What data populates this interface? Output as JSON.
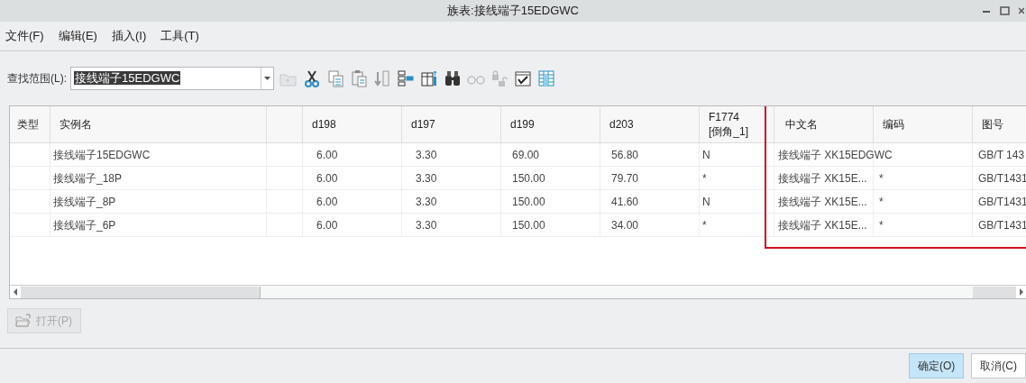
{
  "window": {
    "title": "族表:接线端子15EDGWC"
  },
  "menu": [
    {
      "label": "文件(F)"
    },
    {
      "label": "编辑(E)"
    },
    {
      "label": "插入(I)"
    },
    {
      "label": "工具(T)"
    }
  ],
  "lookup": {
    "label": "查找范围(L):",
    "value": "接线端子15EDGWC"
  },
  "toolbar": [
    {
      "kind": "folder-up",
      "disabled": true
    },
    {
      "kind": "scissors",
      "disabled": false
    },
    {
      "kind": "copy",
      "disabled": false
    },
    {
      "kind": "paste",
      "disabled": false
    },
    {
      "kind": "insert-row",
      "disabled": false
    },
    {
      "kind": "tree",
      "disabled": false
    },
    {
      "kind": "insert-column",
      "disabled": false
    },
    {
      "kind": "binoculars",
      "disabled": false
    },
    {
      "kind": "glasses",
      "disabled": true
    },
    {
      "kind": "locks",
      "disabled": true
    },
    {
      "kind": "checkbox",
      "disabled": false
    },
    {
      "kind": "table",
      "disabled": false
    }
  ],
  "table": {
    "columns": [
      {
        "label": "类型"
      },
      {
        "label": "实例名"
      },
      {
        "label": "d198"
      },
      {
        "label": "d197"
      },
      {
        "label": "d199"
      },
      {
        "label": "d203"
      },
      {
        "label": "F1774\n[倒角_1]"
      },
      {
        "label": "中文名"
      },
      {
        "label": "编码"
      },
      {
        "label": "图号"
      }
    ],
    "rows": [
      [
        "",
        "接线端子15EDGWC",
        "6.00",
        "3.30",
        "69.00",
        "56.80",
        "N",
        "接线端子 XK15EDGWC",
        "",
        "GB/T 143"
      ],
      [
        "",
        "接线端子_18P",
        "6.00",
        "3.30",
        "150.00",
        "79.70",
        "*",
        "接线端子 XK15E...",
        "*",
        "GB/T1431"
      ],
      [
        "",
        "接线端子_8P",
        "6.00",
        "3.30",
        "150.00",
        "41.60",
        "N",
        "接线端子 XK15E...",
        "*",
        "GB/T1431"
      ],
      [
        "",
        "接线端子_6P",
        "6.00",
        "3.30",
        "150.00",
        "34.00",
        "*",
        "接线端子 XK15E...",
        "*",
        "GB/T1431"
      ]
    ],
    "highlight_box": true
  },
  "open_button": {
    "label": "打开(P)",
    "disabled": true
  },
  "buttons": [
    {
      "label": "确定(O)",
      "default": true
    },
    {
      "label": "取消(C)",
      "default": false
    }
  ]
}
